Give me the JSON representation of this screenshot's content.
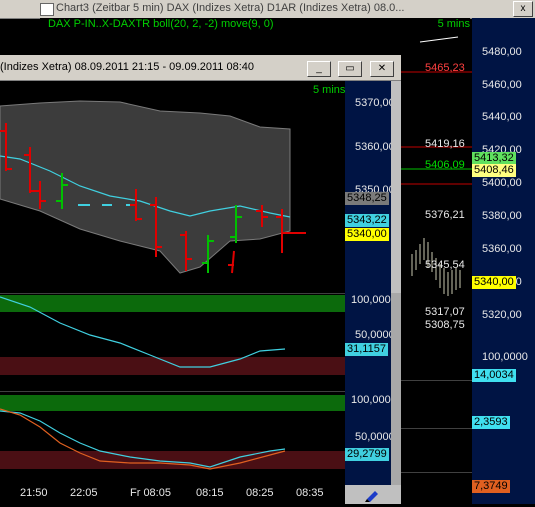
{
  "back_window": {
    "title": "Chart3 (Zeitbar 5 min)  DAX (Indizes Xetra) D1AR (Indizes Xetra) 08.0...",
    "legend": "DAX P-IN..X-DAXTR boll(20, 2, -2) move(9, 0)",
    "interval": "5 mins",
    "price_ticks": [
      "5480,00",
      "5460,00",
      "5440,00",
      "5420,00",
      "5400,00",
      "5380,00",
      "5360,00",
      "5340,00",
      "5320,00"
    ],
    "annotations": {
      "high": "5465,23",
      "upper": "5419,16",
      "mid": "5406,09",
      "level1": "5376,21",
      "level2": "5345,54",
      "level3": "5317,07",
      "low": "5308,75"
    },
    "badges": {
      "b1": "5413,32",
      "b2": "5408,46",
      "b3": "5340,00"
    },
    "lower_panels": {
      "p1_top": "100,0000",
      "p1_value": "14,0034",
      "p2_value": "2,3593",
      "p3_value": "7,3749"
    },
    "controls": {
      "close": "x"
    }
  },
  "front_window": {
    "title": "(Indizes Xetra) 08.09.2011 21:15 - 09.09.2011 08:40",
    "interval": "5 mins",
    "price_ticks": [
      "5370,00",
      "5360,00",
      "5350,00"
    ],
    "price_badges": {
      "upper": "5348,25",
      "mid": "5343,22",
      "last": "5340,00"
    },
    "indicator1": {
      "top": "100,0000",
      "mid": "50,0000",
      "value": "31,1157"
    },
    "indicator2": {
      "top": "100,0000",
      "mid": "50,0000",
      "value": "29,2799"
    },
    "time_labels": [
      "21:50",
      "22:05",
      "Fr 08:05",
      "08:15",
      "08:25",
      "08:35"
    ],
    "controls": {
      "minimize": "_",
      "restore": "▭",
      "close": "✕"
    }
  },
  "colors": {
    "scale_bg": "#001444",
    "up": "#00c000",
    "down": "#e00000",
    "band": "#3c3c3c",
    "ma": "#40d0e0",
    "zone_high": "#0c6a0c",
    "zone_low": "#4a0f14"
  }
}
